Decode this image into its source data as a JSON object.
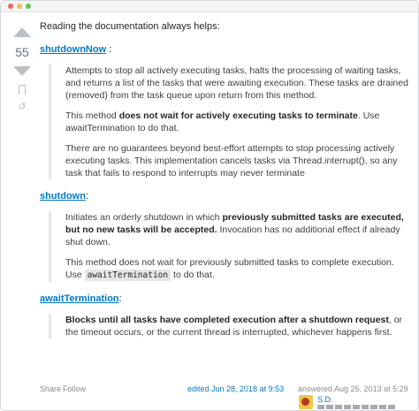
{
  "vote": {
    "count": "55"
  },
  "intro": "Reading the documentation always helps:",
  "methods": [
    {
      "name": "shutdownNow",
      "suffix": " :",
      "paragraphs": [
        [
          {
            "t": "Attempts to stop all actively executing tasks, halts the processing of waiting tasks, and returns a list of the tasks that were awaiting execution. These tasks are drained (removed) from the task queue upon return from this method."
          }
        ],
        [
          {
            "t": "This method "
          },
          {
            "b": "does not wait for actively executing tasks to terminate"
          },
          {
            "t": ". Use awaitTermination to do that."
          }
        ],
        [
          {
            "t": "There are no guarantees beyond best-effort attempts to stop processing actively executing tasks. This implementation cancels tasks via Thread.interrupt(), so any task that fails to respond to interrupts may never terminate"
          }
        ]
      ]
    },
    {
      "name": "shutdown",
      "suffix": ":",
      "paragraphs": [
        [
          {
            "t": "Initiates an orderly shutdown in which "
          },
          {
            "b": "previously submitted tasks are executed, but no new tasks will be accepted."
          },
          {
            "t": " Invocation has no additional effect if already shut down."
          }
        ],
        [
          {
            "t": "This method does not wait for previously submitted tasks to complete execution. Use "
          },
          {
            "c": "awaitTermination"
          },
          {
            "t": " to do that."
          }
        ]
      ]
    },
    {
      "name": "awaitTermination",
      "suffix": ":",
      "paragraphs": [
        [
          {
            "b": "Blocks until all tasks have completed execution after a shutdown request"
          },
          {
            "t": ", or the timeout occurs, or the current thread is interrupted, whichever happens first."
          }
        ]
      ]
    }
  ],
  "footer": {
    "share": "Share",
    "follow": "Follow",
    "edited": "edited Jun 28, 2018 at 9:53",
    "answered": "answered Aug 25, 2013 at 5:29",
    "user_name": "S.D."
  },
  "icons": {
    "upvote": "arrow-up-icon",
    "downvote": "arrow-down-icon",
    "bookmark": "bookmark-icon",
    "history": "history-icon"
  },
  "colors": {
    "link": "#0077cc",
    "muted": "#848d95",
    "vote_arrow": "#bbc0c4"
  }
}
